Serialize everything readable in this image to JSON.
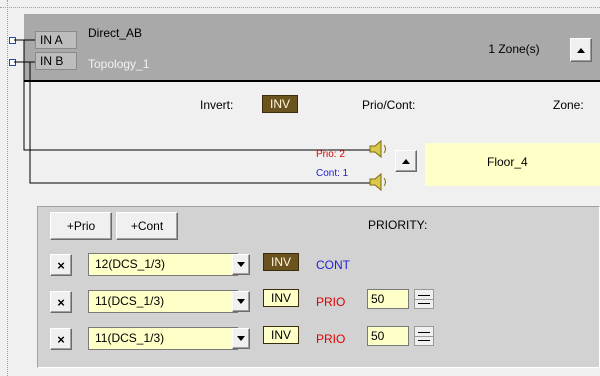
{
  "header": {
    "inputs": [
      {
        "label": "IN A"
      },
      {
        "label": "IN B"
      }
    ],
    "title": "Direct_AB",
    "subtitle": "Topology_1",
    "zones_label": "1 Zone(s)"
  },
  "columns": {
    "invert_label": "Invert:",
    "inv_label": "INV",
    "prio_cont_label": "Prio/Cont:",
    "zone_label": "Zone:"
  },
  "zone_row": {
    "prio_text": "Prio: 2",
    "cont_text": "Cont: 1",
    "zone_name": "Floor_4"
  },
  "priority_panel": {
    "add_prio_label": "+Prio",
    "add_cont_label": "+Cont",
    "priority_label": "PRIORITY:",
    "rows": [
      {
        "remove_label": "×",
        "source": "12(DCS_1/3)",
        "inv": "INV",
        "inv_active": true,
        "kind": "CONT",
        "level": ""
      },
      {
        "remove_label": "×",
        "source": "11(DCS_1/3)",
        "inv": "INV",
        "inv_active": false,
        "kind": "PRIO",
        "level": "50"
      },
      {
        "remove_label": "×",
        "source": "11(DCS_1/3)",
        "inv": "INV",
        "inv_active": false,
        "kind": "PRIO",
        "level": "50"
      }
    ]
  },
  "colors": {
    "header_bg": "#a9a9a9",
    "field_bg": "#ffffc8",
    "inv_active_bg": "#6b5320",
    "prio_color": "#e00000",
    "cont_color": "#1f1fd0",
    "speaker_color": "#d9c84a"
  },
  "icons": {
    "speaker": "speaker-icon",
    "up_arrow": "up-arrow-icon",
    "dropdown_arrow": "dropdown-arrow-icon",
    "spinner": "spinner-icon",
    "remove": "close-icon"
  }
}
